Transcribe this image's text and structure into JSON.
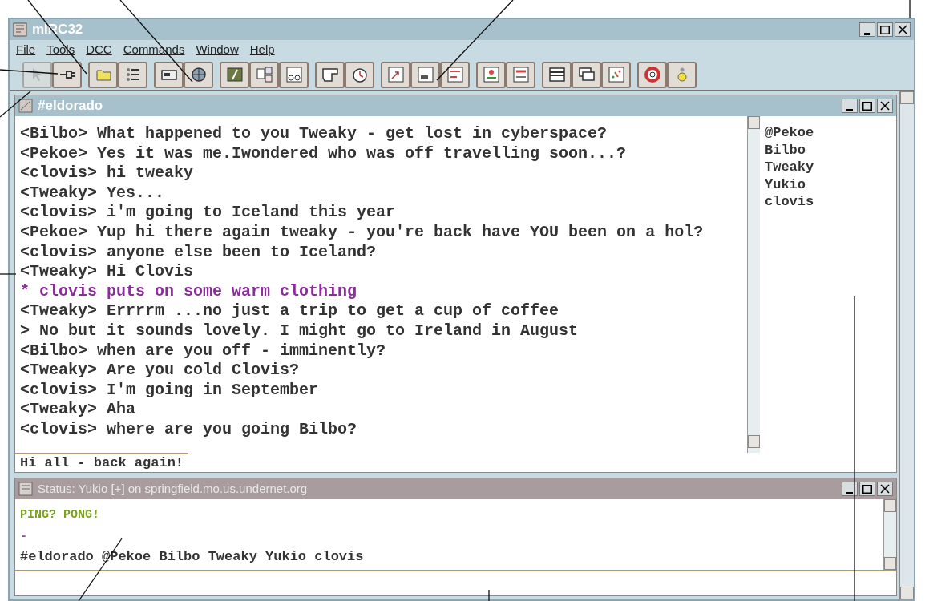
{
  "app": {
    "title": "mIRC32",
    "menu": [
      "File",
      "Tools",
      "DCC",
      "Commands",
      "Window",
      "Help"
    ]
  },
  "toolbar": [
    [
      {
        "disabled": true
      },
      {
        "disabled": false
      }
    ],
    [
      {
        "disabled": false
      },
      {
        "disabled": false
      }
    ],
    [
      {
        "disabled": false
      },
      {
        "disabled": false
      }
    ],
    [
      {
        "disabled": false
      },
      {
        "disabled": false
      },
      {
        "disabled": false
      }
    ],
    [
      {
        "disabled": false
      },
      {
        "disabled": false
      }
    ],
    [
      {
        "disabled": false
      },
      {
        "disabled": false
      },
      {
        "disabled": false
      }
    ],
    [
      {
        "disabled": false
      },
      {
        "disabled": false
      }
    ],
    [
      {
        "disabled": false
      },
      {
        "disabled": false
      },
      {
        "disabled": false
      }
    ],
    [
      {
        "disabled": false
      },
      {
        "disabled": false
      }
    ]
  ],
  "channel": {
    "title": "#eldorado",
    "input": "Hi all - back again!",
    "lines": [
      {
        "kind": "message",
        "text": "<Bilbo> What happened to you Tweaky - get lost in cyberspace?"
      },
      {
        "kind": "message",
        "text": "<Pekoe> Yes it was me.Iwondered who was off travelling soon...?"
      },
      {
        "kind": "message",
        "text": "<clovis> hi tweaky"
      },
      {
        "kind": "message",
        "text": "<Tweaky> Yes..."
      },
      {
        "kind": "message",
        "text": "<clovis> i'm going to Iceland this year"
      },
      {
        "kind": "message",
        "text": "<Pekoe> Yup hi there again tweaky - you're back have YOU been on a hol?"
      },
      {
        "kind": "message",
        "text": "<clovis> anyone else been to Iceland?"
      },
      {
        "kind": "message",
        "text": "<Tweaky> Hi Clovis"
      },
      {
        "kind": "action",
        "text": "* clovis puts on some warm clothing"
      },
      {
        "kind": "message",
        "text": "<Tweaky> Errrrm ...no just a trip to get a cup of coffee"
      },
      {
        "kind": "message",
        "text": "> No but it sounds lovely. I might go to Ireland in August"
      },
      {
        "kind": "message",
        "text": "<Bilbo> when are you off - imminently?"
      },
      {
        "kind": "message",
        "text": "<Tweaky> Are you cold Clovis?"
      },
      {
        "kind": "message",
        "text": "<clovis> I'm going in September"
      },
      {
        "kind": "message",
        "text": "<Tweaky> Aha"
      },
      {
        "kind": "message",
        "text": "<clovis> where are you going Bilbo?"
      }
    ],
    "nicks": [
      "@Pekoe",
      "Bilbo",
      "Tweaky",
      "Yukio",
      "clovis"
    ]
  },
  "status": {
    "title": "Status: Yukio [+] on springfield.mo.us.undernet.org",
    "lines": [
      {
        "kind": "server",
        "text": "PING? PONG!"
      },
      {
        "kind": "separator",
        "text": "-"
      },
      {
        "kind": "message",
        "text": "#eldorado @Pekoe Bilbo Tweaky Yukio clovis"
      }
    ]
  }
}
